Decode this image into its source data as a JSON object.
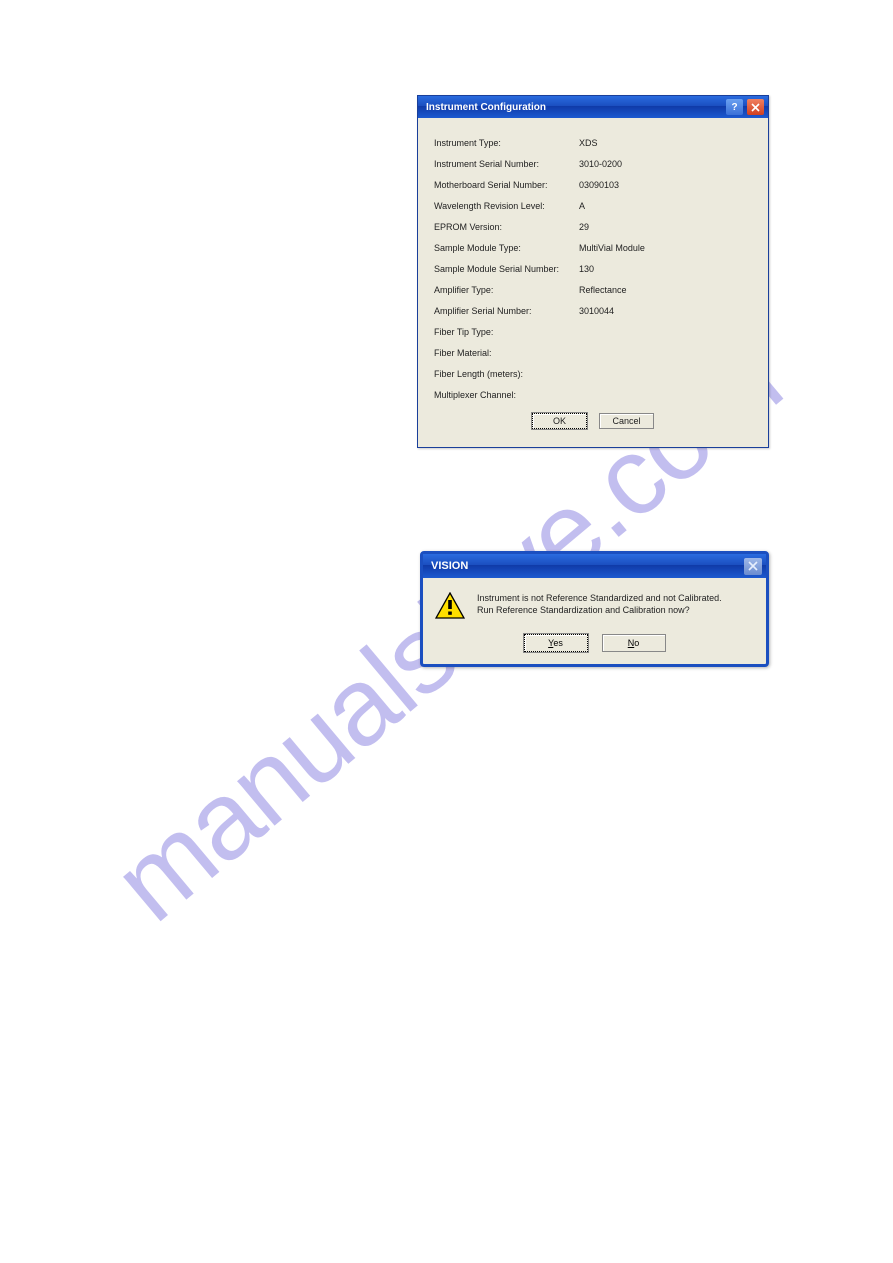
{
  "watermark": "manualshive.com",
  "config_dialog": {
    "title": "Instrument Configuration",
    "rows": [
      {
        "label": "Instrument Type:",
        "value": "XDS"
      },
      {
        "label": "Instrument Serial Number:",
        "value": "3010-0200"
      },
      {
        "label": "Motherboard Serial Number:",
        "value": "03090103"
      },
      {
        "label": "Wavelength Revision Level:",
        "value": "A"
      },
      {
        "label": "EPROM Version:",
        "value": "29"
      },
      {
        "label": "Sample Module Type:",
        "value": "MultiVial Module"
      },
      {
        "label": "Sample Module Serial Number:",
        "value": "130"
      },
      {
        "label": "Amplifier Type:",
        "value": "Reflectance"
      },
      {
        "label": "Amplifier Serial Number:",
        "value": "3010044"
      },
      {
        "label": "Fiber Tip Type:",
        "value": ""
      },
      {
        "label": "Fiber Material:",
        "value": ""
      },
      {
        "label": "Fiber Length (meters):",
        "value": ""
      },
      {
        "label": "Multiplexer Channel:",
        "value": ""
      }
    ],
    "ok_label": "OK",
    "cancel_label": "Cancel"
  },
  "message_dialog": {
    "title": "VISION",
    "line1": "Instrument is not Reference Standardized and not Calibrated.",
    "line2": "Run Reference Standardization and Calibration now?",
    "yes_label": "Yes",
    "no_label": "No"
  }
}
